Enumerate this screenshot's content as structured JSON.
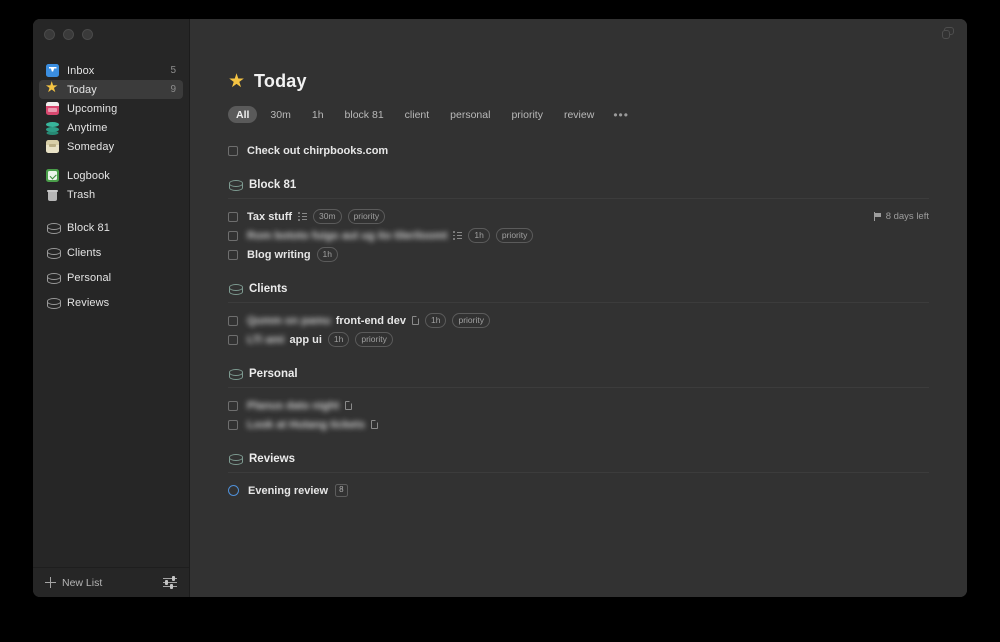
{
  "window": {
    "traffic_lights": [
      "close",
      "minimize",
      "zoom"
    ],
    "corner_icon": "window-duplicate-icon",
    "bg": "#323232",
    "sidebar_bg": "#262626"
  },
  "sidebar": {
    "groups": [
      {
        "items": [
          {
            "label": "Inbox",
            "icon": "inbox-icon",
            "count": "5",
            "selected": false
          },
          {
            "label": "Today",
            "icon": "star-icon",
            "count": "9",
            "selected": true
          },
          {
            "label": "Upcoming",
            "icon": "calendar-icon",
            "count": "",
            "selected": false
          },
          {
            "label": "Anytime",
            "icon": "layers-icon",
            "count": "",
            "selected": false
          },
          {
            "label": "Someday",
            "icon": "box-icon",
            "count": "",
            "selected": false
          }
        ]
      },
      {
        "items": [
          {
            "label": "Logbook",
            "icon": "logbook-icon",
            "count": "",
            "selected": false
          },
          {
            "label": "Trash",
            "icon": "trash-icon",
            "count": "",
            "selected": false
          }
        ]
      },
      {
        "items": [
          {
            "label": "Block 81",
            "icon": "list-icon",
            "count": "",
            "selected": false
          },
          {
            "label": "Clients",
            "icon": "list-icon",
            "count": "",
            "selected": false
          },
          {
            "label": "Personal",
            "icon": "list-icon",
            "count": "",
            "selected": false
          },
          {
            "label": "Reviews",
            "icon": "list-icon",
            "count": "",
            "selected": false
          }
        ]
      }
    ],
    "footer": {
      "new_list_label": "New List",
      "new_list_icon": "plus-icon",
      "settings_icon": "sliders-icon"
    }
  },
  "header": {
    "icon": "star-icon",
    "title": "Today"
  },
  "filters": {
    "chips": [
      {
        "label": "All",
        "active": true
      },
      {
        "label": "30m",
        "active": false
      },
      {
        "label": "1h",
        "active": false
      },
      {
        "label": "block 81",
        "active": false
      },
      {
        "label": "client",
        "active": false
      },
      {
        "label": "personal",
        "active": false
      },
      {
        "label": "priority",
        "active": false
      },
      {
        "label": "review",
        "active": false
      }
    ],
    "more_label": "•••"
  },
  "loose_tasks": [
    {
      "title": "Check out chirpbooks.com",
      "blurred": false,
      "checkbox": "square",
      "icons": [],
      "pills": [],
      "badge": "",
      "deadline": ""
    }
  ],
  "groups": [
    {
      "title": "Block 81",
      "icon": "list-icon",
      "tasks": [
        {
          "title": "Tax stuff",
          "blurred": false,
          "checkbox": "square",
          "icons": [
            "checklist-icon"
          ],
          "pills": [
            "30m",
            "priority"
          ],
          "badge": "",
          "deadline": "8 days left",
          "deadline_icon": "flag-icon"
        },
        {
          "title": "Rom bototo fuigo aut ug ito tileriloomt",
          "blurred": true,
          "checkbox": "square",
          "icons": [
            "checklist-icon"
          ],
          "pills": [
            "1h",
            "priority"
          ],
          "badge": "",
          "deadline": ""
        },
        {
          "title": "Blog writing",
          "blurred": false,
          "checkbox": "square",
          "icons": [],
          "pills": [
            "1h"
          ],
          "badge": "",
          "deadline": ""
        }
      ]
    },
    {
      "title": "Clients",
      "icon": "list-icon",
      "tasks": [
        {
          "title": "",
          "blurred_prefix": "Qumm on pamu",
          "title_suffix": "front-end dev",
          "blurred": false,
          "checkbox": "square",
          "icons": [
            "note-icon"
          ],
          "pills": [
            "1h",
            "priority"
          ],
          "badge": "",
          "deadline": ""
        },
        {
          "title": "",
          "blurred_prefix": "LTi ami",
          "title_suffix": "app ui",
          "blurred": false,
          "checkbox": "square",
          "icons": [],
          "pills": [
            "1h",
            "priority"
          ],
          "badge": "",
          "deadline": ""
        }
      ]
    },
    {
      "title": "Personal",
      "icon": "list-icon",
      "tasks": [
        {
          "title": "Planus dato night",
          "blurred": true,
          "checkbox": "square",
          "icons": [
            "note-icon"
          ],
          "pills": [],
          "badge": "",
          "deadline": ""
        },
        {
          "title": "Look at Hutang tickets",
          "blurred": true,
          "checkbox": "square",
          "icons": [
            "note-icon"
          ],
          "pills": [],
          "badge": "",
          "deadline": ""
        }
      ]
    },
    {
      "title": "Reviews",
      "icon": "list-icon",
      "tasks": [
        {
          "title": "Evening review",
          "blurred": false,
          "checkbox": "circle",
          "icons": [],
          "pills": [],
          "badge": "8",
          "deadline": ""
        }
      ]
    }
  ]
}
